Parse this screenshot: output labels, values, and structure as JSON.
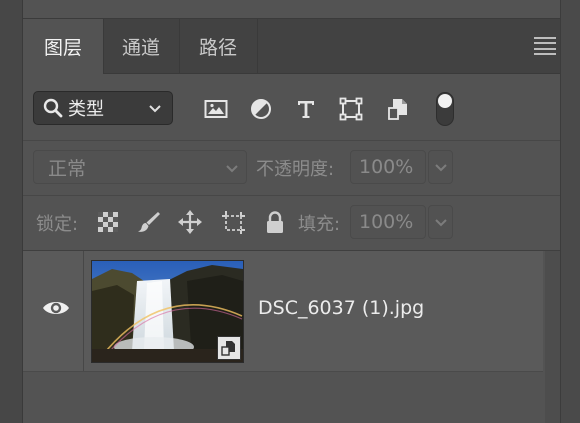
{
  "tabs": [
    {
      "label": "图层",
      "active": true
    },
    {
      "label": "通道",
      "active": false
    },
    {
      "label": "路径",
      "active": false
    }
  ],
  "filter": {
    "kind_label": "类型",
    "icons": [
      "image-filter-icon",
      "adjustment-filter-icon",
      "type-filter-icon",
      "shape-filter-icon",
      "smart-object-filter-icon"
    ],
    "toggle_on": true
  },
  "blend": {
    "mode": "正常",
    "opacity_label": "不透明度:",
    "opacity_value": "100%"
  },
  "lock": {
    "label": "锁定:",
    "icons": [
      "lock-transparent-pixels-icon",
      "lock-image-pixels-icon",
      "lock-position-icon",
      "lock-artboard-icon",
      "lock-all-icon"
    ],
    "fill_label": "填充:",
    "fill_value": "100%"
  },
  "layers": [
    {
      "name": "DSC_6037 (1).jpg",
      "visible": true,
      "smart_object": true
    }
  ],
  "colors": {
    "panel_bg": "#535353",
    "tabbar_bg": "#424242",
    "text": "#e4e4e4",
    "muted_text": "#8c8c8c"
  }
}
